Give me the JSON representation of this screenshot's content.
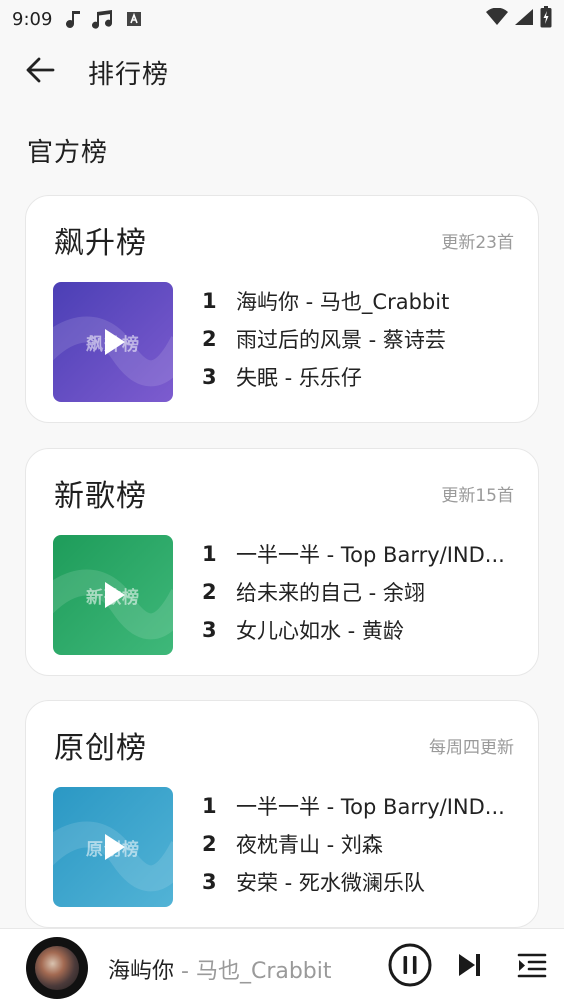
{
  "status_bar": {
    "time": "9:09"
  },
  "header": {
    "title": "排行榜"
  },
  "section_title": "官方榜",
  "charts": [
    {
      "name": "飙升榜",
      "update": "更新23首",
      "cover_label": "飙升榜",
      "cover_colors": [
        "#4b3fb5",
        "#7d5ccf"
      ],
      "tracks": [
        {
          "num": "1",
          "text": "海屿你 - 马也_Crabbit"
        },
        {
          "num": "2",
          "text": "雨过后的风景 - 蔡诗芸"
        },
        {
          "num": "3",
          "text": "失眠 - 乐乐仔"
        }
      ]
    },
    {
      "name": "新歌榜",
      "update": "更新15首",
      "cover_label": "新歌榜",
      "cover_colors": [
        "#1e9c5a",
        "#3fb87a"
      ],
      "tracks": [
        {
          "num": "1",
          "text": "一半一半 - Top Barry/IND..."
        },
        {
          "num": "2",
          "text": "给未来的自己 - 余翊"
        },
        {
          "num": "3",
          "text": "女儿心如水 - 黄龄"
        }
      ]
    },
    {
      "name": "原创榜",
      "update": "每周四更新",
      "cover_label": "原创榜",
      "cover_colors": [
        "#2b98c4",
        "#52b3d6"
      ],
      "tracks": [
        {
          "num": "1",
          "text": "一半一半 - Top Barry/IND..."
        },
        {
          "num": "2",
          "text": "夜枕青山 - 刘森"
        },
        {
          "num": "3",
          "text": "安荣 - 死水微澜乐队"
        }
      ]
    }
  ],
  "player": {
    "song": "海屿你",
    "separator": " - ",
    "artist": "马也_Crabbit"
  }
}
